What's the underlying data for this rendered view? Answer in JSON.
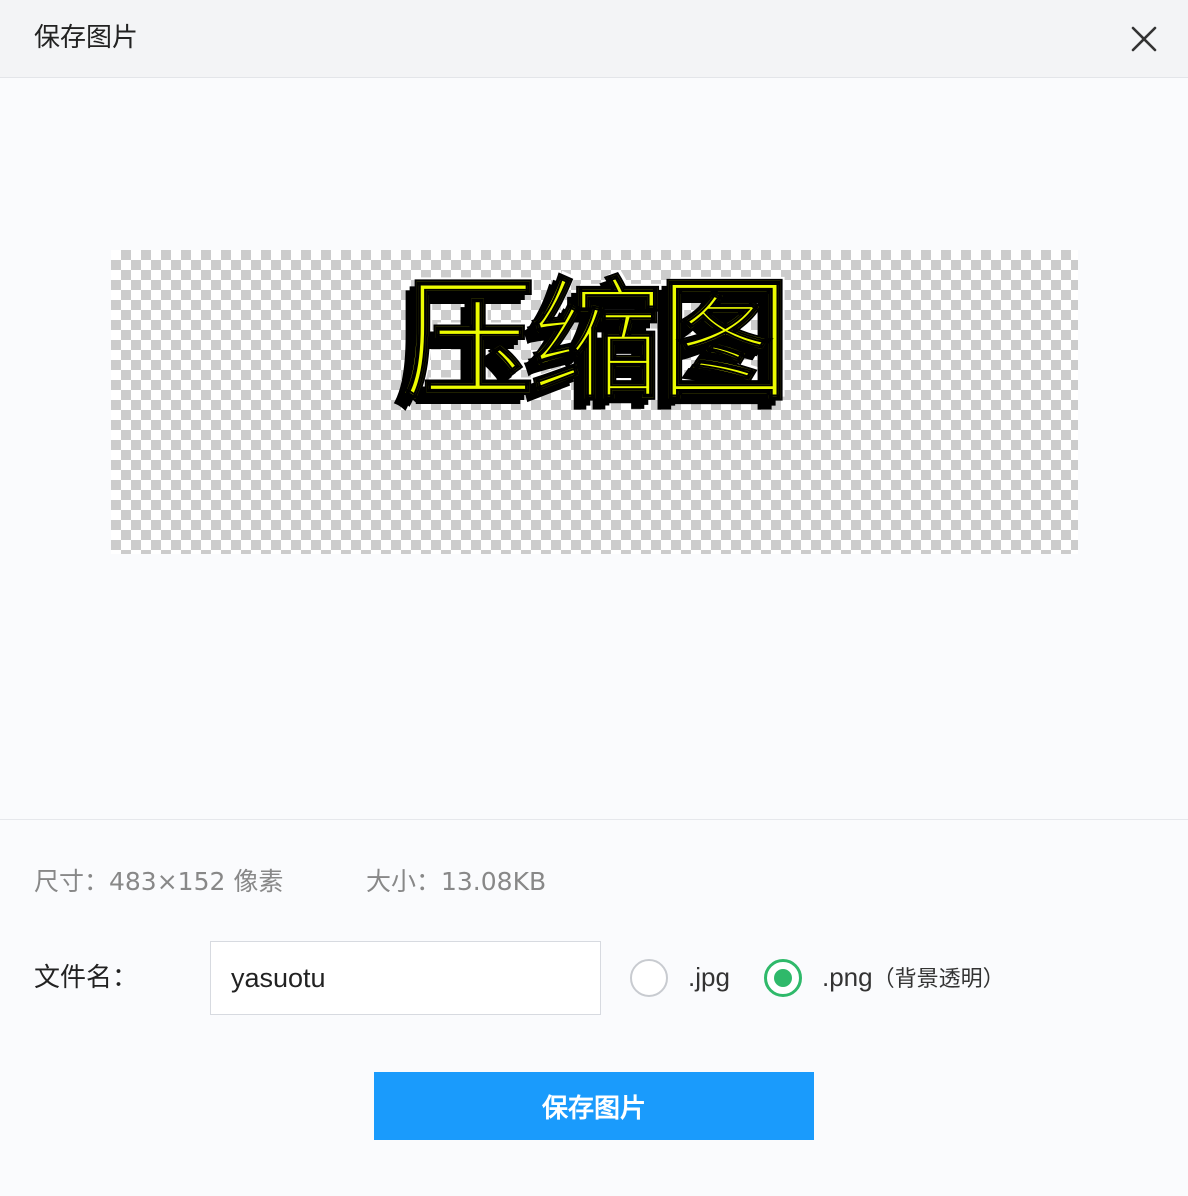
{
  "dialog": {
    "title": "保存图片",
    "close_icon": "close-icon"
  },
  "preview": {
    "image_text": "压缩图",
    "text_color": "#ecfc00"
  },
  "info": {
    "size_label": "尺寸：483×152 像素",
    "filesize_label": "大小：13.08KB"
  },
  "form": {
    "filename_label": "文件名：",
    "filename_value": "yasuotu",
    "formats": [
      {
        "label": ".jpg",
        "note": "",
        "selected": false
      },
      {
        "label": ".png",
        "note": "（背景透明）",
        "selected": true
      }
    ],
    "accent_color": "#2fb96a"
  },
  "actions": {
    "save_label": "保存图片",
    "button_color": "#1a9bfc"
  }
}
